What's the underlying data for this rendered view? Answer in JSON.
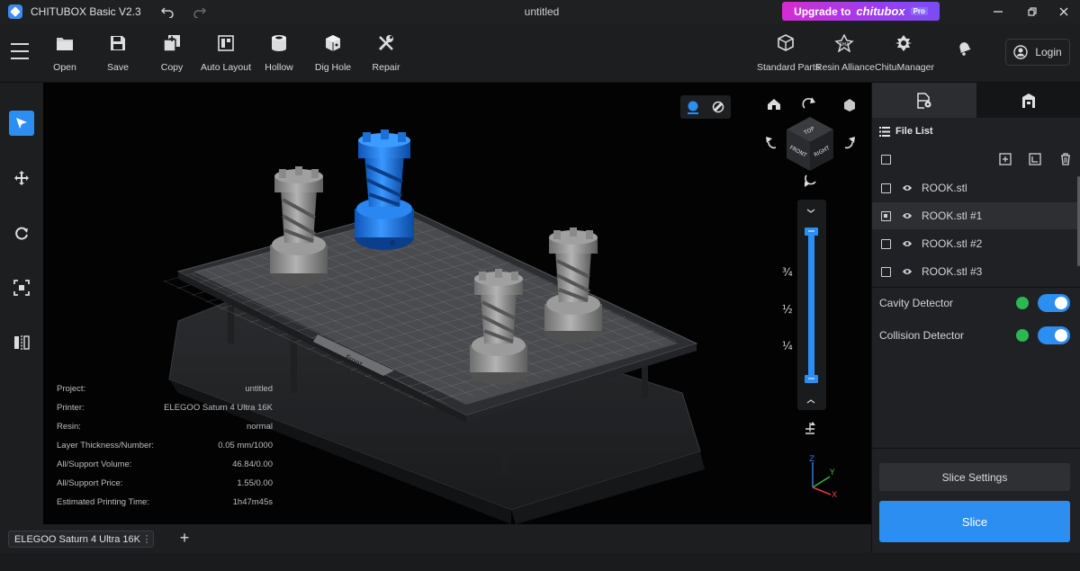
{
  "titlebar": {
    "app_title": "CHITUBOX Basic V2.3",
    "document_title": "untitled",
    "upgrade_prefix": "Upgrade to",
    "upgrade_brand": "chitubox",
    "upgrade_badge": "Pro"
  },
  "toolbar": {
    "tools": [
      {
        "label": "Open",
        "icon": "folder-icon"
      },
      {
        "label": "Save",
        "icon": "save-icon"
      },
      {
        "label": "Copy",
        "icon": "copy-icon"
      },
      {
        "label": "Auto Layout",
        "icon": "auto-layout-icon"
      },
      {
        "label": "Hollow",
        "icon": "hollow-icon"
      },
      {
        "label": "Dig Hole",
        "icon": "dig-hole-icon"
      },
      {
        "label": "Repair",
        "icon": "repair-icon"
      }
    ],
    "right_tools": [
      {
        "label": "Standard Parts",
        "icon": "standard-parts-icon"
      },
      {
        "label": "Resin Alliance",
        "icon": "resin-alliance-icon"
      },
      {
        "label": "ChituManager",
        "icon": "chitu-manager-icon"
      }
    ],
    "login_label": "Login"
  },
  "left_tools": [
    "select-icon",
    "move-icon",
    "rotate-icon",
    "scale-icon",
    "mirror-icon"
  ],
  "viewport": {
    "view_cube": {
      "top": "TOP",
      "front": "FRONT",
      "right": "RIGHT"
    },
    "plate_label": "Front",
    "slider_marks": [
      "¾",
      "½",
      "¼"
    ],
    "axes": {
      "x": "X",
      "y": "Y",
      "z": "Z"
    },
    "info": [
      {
        "label": "Project:",
        "value": "untitled"
      },
      {
        "label": "Printer:",
        "value": "ELEGOO Saturn 4 Ultra 16K"
      },
      {
        "label": "Resin:",
        "value": "normal"
      },
      {
        "label": "Layer Thickness/Number:",
        "value": "0.05 mm/1000"
      },
      {
        "label": "All/Support Volume:",
        "value": "46.84/0.00"
      },
      {
        "label": "All/Support Price:",
        "value": "1.55/0.00"
      },
      {
        "label": "Estimated Printing Time:",
        "value": "1h47m45s"
      }
    ]
  },
  "right_panel": {
    "file_list_title": "File List",
    "files": [
      {
        "name": "ROOK.stl",
        "checked": false
      },
      {
        "name": "ROOK.stl #1",
        "checked": true
      },
      {
        "name": "ROOK.stl #2",
        "checked": false
      },
      {
        "name": "ROOK.stl #3",
        "checked": false
      }
    ],
    "detectors": [
      {
        "label": "Cavity Detector",
        "enabled": true
      },
      {
        "label": "Collision Detector",
        "enabled": true
      }
    ],
    "slice_settings_label": "Slice Settings",
    "slice_label": "Slice"
  },
  "bottom": {
    "printer_tab": "ELEGOO Saturn 4 Ultra 16K"
  },
  "colors": {
    "accent": "#2b8ef0",
    "selected_model": "#1f7ee8",
    "model": "#8a8a8a",
    "status_ok": "#2bb852"
  }
}
